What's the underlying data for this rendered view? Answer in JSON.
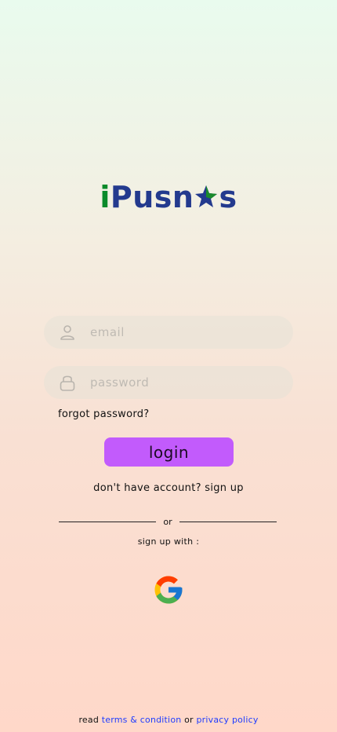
{
  "logo": {
    "part_i": "i",
    "part_pus": "Pusn",
    "part_s": "s",
    "star_colors": {
      "green": "#1b8a2c",
      "blue": "#233a8e"
    }
  },
  "form": {
    "email": {
      "placeholder": "email",
      "value": "",
      "icon": "user-icon"
    },
    "password": {
      "placeholder": "password",
      "value": "",
      "icon": "lock-icon"
    },
    "forgot_label": "forgot password?",
    "login_label": "login",
    "login_color": "#c25bfc"
  },
  "signup": {
    "prompt": "don't have account?",
    "link": "sign up"
  },
  "divider": {
    "or": "or"
  },
  "social": {
    "label": "sign up with :",
    "google_icon": "google-icon"
  },
  "footer": {
    "read": "read",
    "terms": "terms & condition",
    "or": "or",
    "privacy": "privacy policy",
    "link_color": "#1f3cff"
  }
}
